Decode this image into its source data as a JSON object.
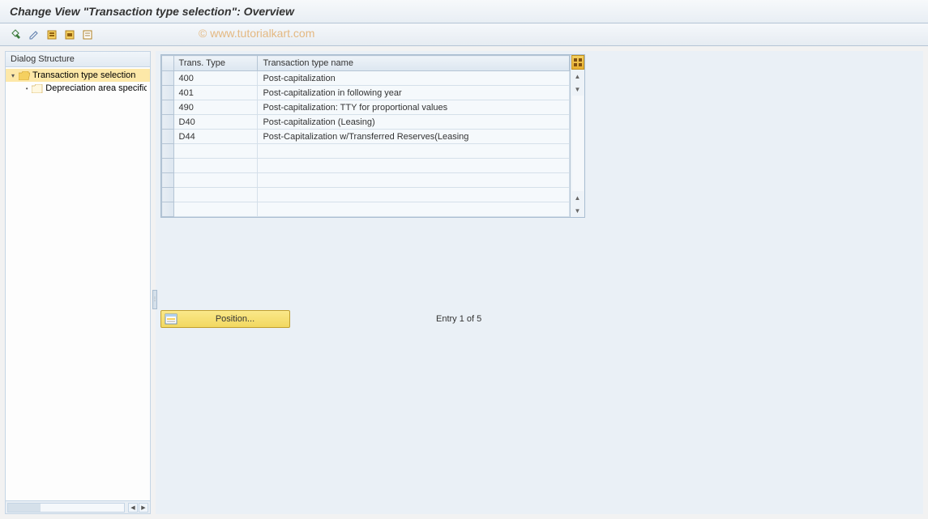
{
  "title": "Change View \"Transaction type selection\": Overview",
  "watermark": "© www.tutorialkart.com",
  "toolbar": {
    "btn1": "display-change-toggle",
    "btn2": "other-entry",
    "btn3": "select-all",
    "btn4": "select-block",
    "btn5": "deselect-all"
  },
  "sidebar": {
    "header": "Dialog Structure",
    "items": [
      {
        "label": "Transaction type selection",
        "selected": true,
        "level": 0
      },
      {
        "label": "Depreciation area specification",
        "selected": false,
        "level": 1
      }
    ]
  },
  "table": {
    "columns": [
      "Trans. Type",
      "Transaction type name"
    ],
    "rows": [
      {
        "type": "400",
        "name": "Post-capitalization"
      },
      {
        "type": "401",
        "name": "Post-capitalization in following year"
      },
      {
        "type": "490",
        "name": "Post-capitalization: TTY for proportional values"
      },
      {
        "type": "D40",
        "name": "Post-capitalization (Leasing)"
      },
      {
        "type": "D44",
        "name": "Post-Capitalization w/Transferred Reserves(Leasing"
      }
    ],
    "empty_rows": 5
  },
  "position_button": "Position...",
  "entry_info": "Entry 1 of 5"
}
